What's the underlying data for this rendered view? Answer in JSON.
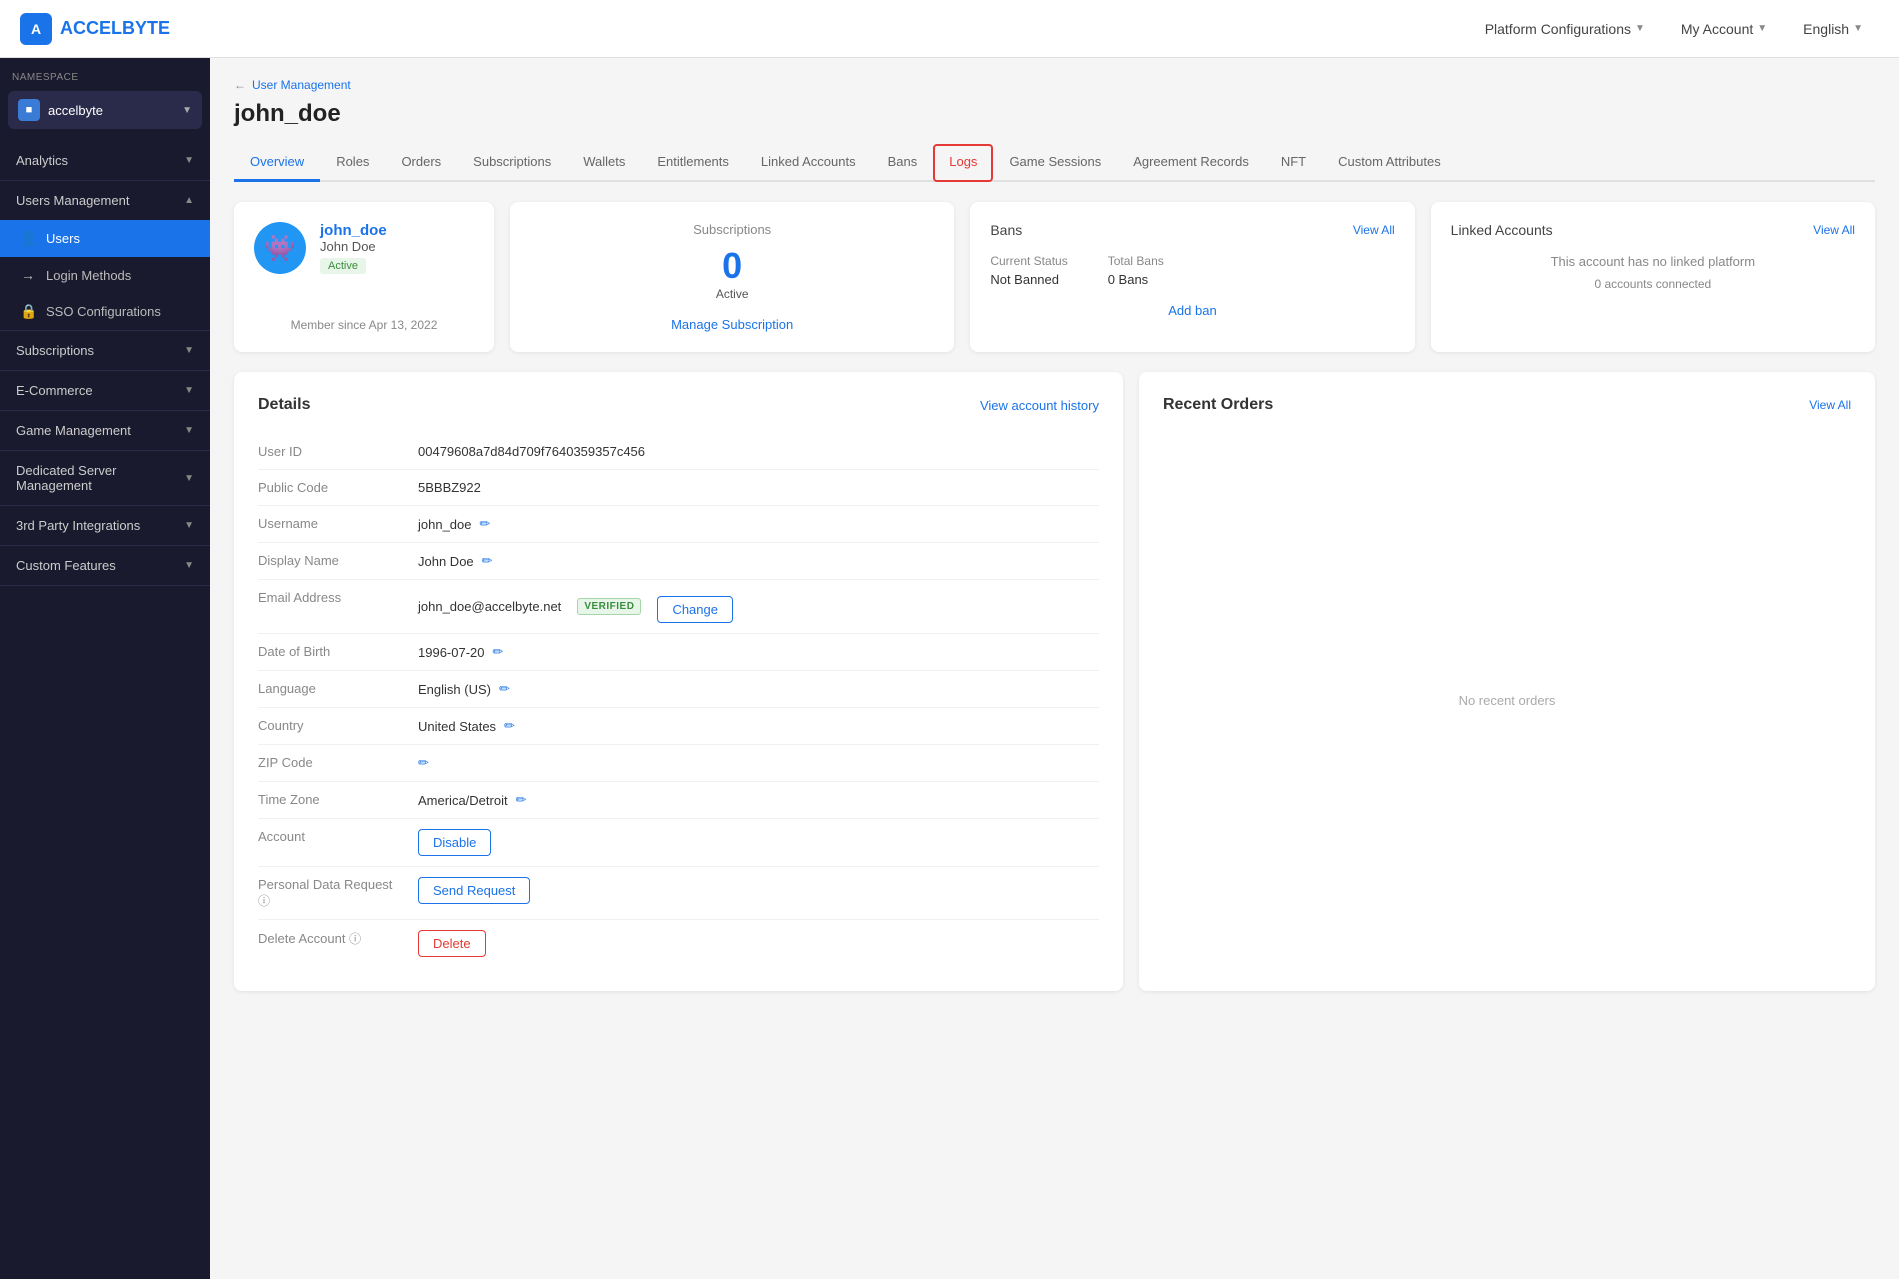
{
  "topnav": {
    "logo_text": "ACCELBYTE",
    "logo_icon": "A",
    "platform_config": "Platform Configurations",
    "my_account": "My Account",
    "language": "English"
  },
  "sidebar": {
    "namespace_label": "NAMESPACE",
    "namespace_name": "accelbyte",
    "sections": [
      {
        "id": "analytics",
        "label": "Analytics",
        "chevron": "▼",
        "expanded": false
      },
      {
        "id": "users-management",
        "label": "Users Management",
        "chevron": "▲",
        "expanded": true
      },
      {
        "id": "subscriptions",
        "label": "Subscriptions",
        "chevron": "▼",
        "expanded": false
      },
      {
        "id": "ecommerce",
        "label": "E-Commerce",
        "chevron": "▼",
        "expanded": false
      },
      {
        "id": "game-management",
        "label": "Game Management",
        "chevron": "▼",
        "expanded": false
      },
      {
        "id": "dedicated-server",
        "label": "Dedicated Server Management",
        "chevron": "▼",
        "expanded": false
      },
      {
        "id": "3rd-party",
        "label": "3rd Party Integrations",
        "chevron": "▼",
        "expanded": false
      },
      {
        "id": "custom-features",
        "label": "Custom Features",
        "chevron": "▼",
        "expanded": false
      }
    ],
    "users_management_items": [
      {
        "id": "users",
        "label": "Users",
        "icon": "👤",
        "active": true
      },
      {
        "id": "login-methods",
        "label": "Login Methods",
        "icon": "→",
        "active": false
      },
      {
        "id": "sso-configurations",
        "label": "SSO Configurations",
        "icon": "🔒",
        "active": false
      }
    ]
  },
  "breadcrumb": {
    "parent": "User Management",
    "arrow": "←"
  },
  "page": {
    "title": "john_doe"
  },
  "tabs": [
    {
      "id": "overview",
      "label": "Overview",
      "active": true,
      "highlighted": false
    },
    {
      "id": "roles",
      "label": "Roles",
      "active": false,
      "highlighted": false
    },
    {
      "id": "orders",
      "label": "Orders",
      "active": false,
      "highlighted": false
    },
    {
      "id": "subscriptions",
      "label": "Subscriptions",
      "active": false,
      "highlighted": false
    },
    {
      "id": "wallets",
      "label": "Wallets",
      "active": false,
      "highlighted": false
    },
    {
      "id": "entitlements",
      "label": "Entitlements",
      "active": false,
      "highlighted": false
    },
    {
      "id": "linked-accounts",
      "label": "Linked Accounts",
      "active": false,
      "highlighted": false
    },
    {
      "id": "bans",
      "label": "Bans",
      "active": false,
      "highlighted": false
    },
    {
      "id": "logs",
      "label": "Logs",
      "active": false,
      "highlighted": true
    },
    {
      "id": "game-sessions",
      "label": "Game Sessions",
      "active": false,
      "highlighted": false
    },
    {
      "id": "agreement-records",
      "label": "Agreement Records",
      "active": false,
      "highlighted": false
    },
    {
      "id": "nft",
      "label": "NFT",
      "active": false,
      "highlighted": false
    },
    {
      "id": "custom-attributes",
      "label": "Custom Attributes",
      "active": false,
      "highlighted": false
    }
  ],
  "user_card": {
    "username": "john_doe",
    "display_name": "John Doe",
    "status": "Active",
    "member_since": "Member since Apr 13, 2022",
    "avatar_icon": "👾"
  },
  "subscriptions_card": {
    "label": "Subscriptions",
    "count": "0",
    "sub_label": "Active",
    "manage_link": "Manage Subscription"
  },
  "bans_card": {
    "title": "Bans",
    "view_all": "View All",
    "current_status_label": "Current Status",
    "current_status_value": "Not Banned",
    "total_bans_label": "Total Bans",
    "total_bans_value": "0 Bans",
    "add_ban": "Add ban"
  },
  "linked_card": {
    "title": "Linked Accounts",
    "view_all": "View All",
    "no_linked": "This account has no linked platform",
    "count_label": "0 accounts connected"
  },
  "details": {
    "title": "Details",
    "view_history": "View account history",
    "fields": [
      {
        "label": "User ID",
        "value": "00479608a7d84d709f7640359357c456",
        "editable": false
      },
      {
        "label": "Public Code",
        "value": "5BBBZ922",
        "editable": false
      },
      {
        "label": "Username",
        "value": "john_doe",
        "editable": true
      },
      {
        "label": "Display Name",
        "value": "John Doe",
        "editable": true
      },
      {
        "label": "Email Address",
        "value": "john_doe@accelbyte.net",
        "editable": false,
        "verified": true,
        "has_change_btn": true
      },
      {
        "label": "Date of Birth",
        "value": "1996-07-20",
        "editable": true
      },
      {
        "label": "Language",
        "value": "English (US)",
        "editable": true
      },
      {
        "label": "Country",
        "value": "United States",
        "editable": true
      },
      {
        "label": "ZIP Code",
        "value": "",
        "editable": true
      },
      {
        "label": "Time Zone",
        "value": "America/Detroit",
        "editable": true
      },
      {
        "label": "Account",
        "value": "",
        "editable": false,
        "has_disable_btn": true
      },
      {
        "label": "Personal Data Request",
        "value": "",
        "editable": false,
        "has_info": true,
        "has_send_btn": true
      },
      {
        "label": "Delete Account",
        "value": "",
        "editable": false,
        "has_info": true,
        "has_delete_btn": true
      }
    ],
    "change_btn": "Change",
    "disable_btn": "Disable",
    "send_request_btn": "Send Request",
    "delete_btn": "Delete",
    "verified_label": "VERIFIED"
  },
  "orders": {
    "title": "Recent Orders",
    "view_all": "View All",
    "empty_label": "No recent orders"
  }
}
